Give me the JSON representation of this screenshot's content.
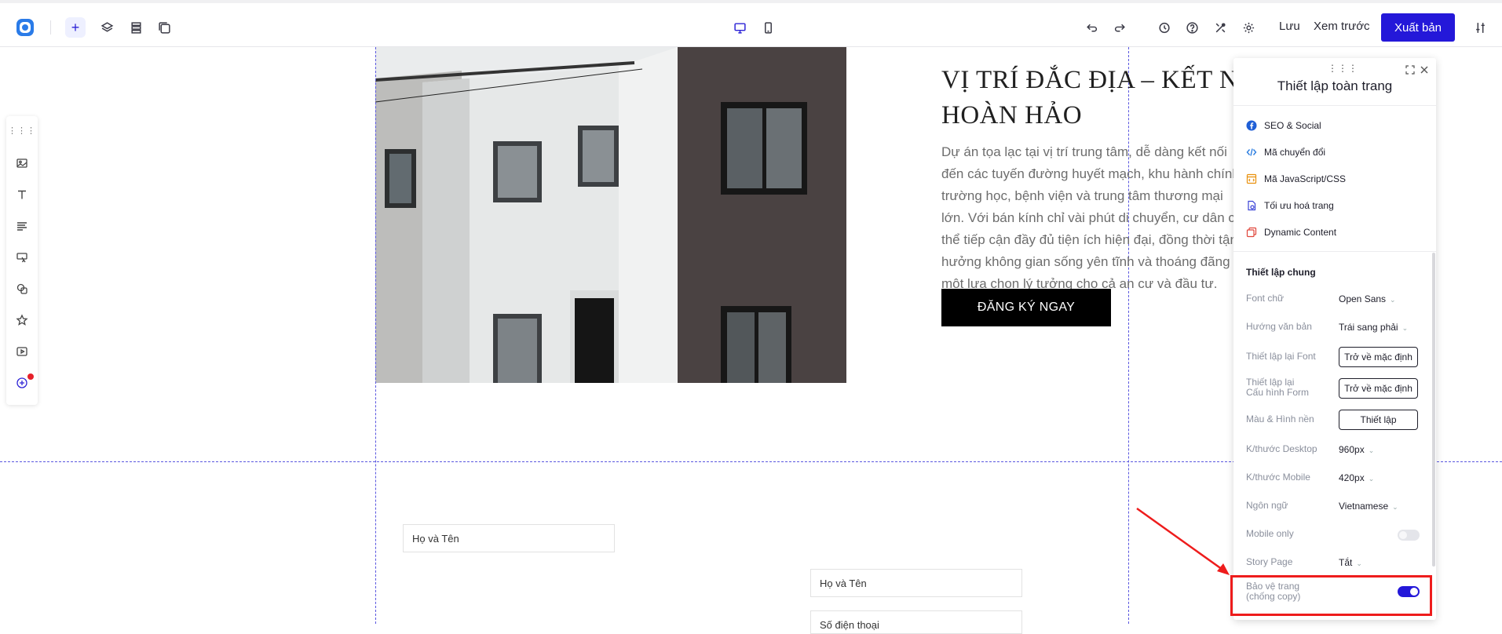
{
  "topbar": {
    "save_label": "Lưu",
    "preview_label": "Xem trước",
    "publish_label": "Xuất bản",
    "brand_color": "#2418d9"
  },
  "hero": {
    "heading": "VỊ TRÍ ĐẮC ĐỊA – KẾT NỐI\nHOÀN HẢO",
    "paragraph": "Dự án tọa lạc tại vị trí trung tâm, dễ dàng kết nối đến các tuyến đường huyết mạch, khu hành chính, trường học, bệnh viện và trung tâm thương mại lớn. Với bán kính chỉ vài phút di chuyển, cư dân có thể tiếp cận đầy đủ tiện ích hiện đại, đồng thời tận hưởng không gian sống yên tĩnh và thoáng đãng – một lựa chọn lý tưởng cho cả an cư và đầu tư.",
    "cta_label": "ĐĂNG KÝ NGAY"
  },
  "form": {
    "field1_placeholder": "Họ và Tên",
    "field2_placeholder": "Họ và Tên",
    "field3_placeholder": "Số điện thoại"
  },
  "panel": {
    "title": "Thiết lập toàn trang",
    "menu": [
      {
        "label": "SEO & Social",
        "icon": "facebook-icon"
      },
      {
        "label": "Mã chuyển đổi",
        "icon": "code-icon"
      },
      {
        "label": "Mã JavaScript/CSS",
        "icon": "file-code-icon"
      },
      {
        "label": "Tối ưu hoá trang",
        "icon": "page-optimize-icon"
      },
      {
        "label": "Dynamic Content",
        "icon": "dynamic-content-icon"
      }
    ],
    "section_title": "Thiết lập chung",
    "rows": {
      "font_label": "Font chữ",
      "font_value": "Open Sans",
      "direction_label": "Hướng văn bản",
      "direction_value": "Trái sang phải",
      "reset_font_label": "Thiết lập lại Font",
      "reset_font_button": "Trở về mặc định",
      "reset_form_label": "Thiết lập lại\nCấu hình Form",
      "reset_form_button": "Trở về mặc định",
      "bg_label": "Màu & Hình nền",
      "bg_button": "Thiết lập",
      "desktop_label": "K/thước Desktop",
      "desktop_value": "960px",
      "mobile_label": "K/thước Mobile",
      "mobile_value": "420px",
      "language_label": "Ngôn ngữ",
      "language_value": "Vietnamese",
      "mobile_only_label": "Mobile only",
      "mobile_only_on": false,
      "story_label": "Story Page",
      "story_value": "Tắt",
      "protect_label": "Bảo vệ trang\n(chống copy)",
      "protect_on": true
    }
  }
}
